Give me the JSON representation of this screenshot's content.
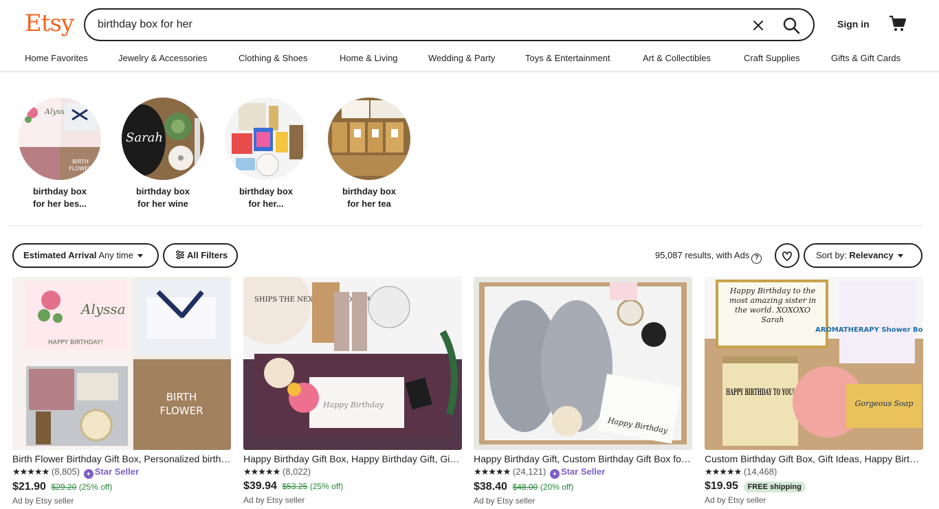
{
  "header": {
    "logo": "Etsy",
    "search_value": "birthday box for her",
    "sign_in": "Sign in"
  },
  "nav": [
    "Home Favorites",
    "Jewelry & Accessories",
    "Clothing & Shoes",
    "Home & Living",
    "Wedding & Party",
    "Toys & Entertainment",
    "Art & Collectibles",
    "Craft Supplies",
    "Gifts & Gift Cards"
  ],
  "related": [
    {
      "line1": "birthday box",
      "line2": "for her bes..."
    },
    {
      "line1": "birthday box",
      "line2": "for her wine"
    },
    {
      "line1": "birthday box",
      "line2": "for her..."
    },
    {
      "line1": "birthday box",
      "line2": "for her tea"
    }
  ],
  "filters": {
    "arrival_label": "Estimated Arrival",
    "arrival_value": "Any time",
    "all_filters": "All Filters",
    "results": "95,087 results, with Ads",
    "sort_label": "Sort by:",
    "sort_value": "Relevancy"
  },
  "products": [
    {
      "title": "Birth Flower Birthday Gift Box, Personalized birthday gift for her",
      "stars": "★★★★★",
      "reviews": "(8,805)",
      "star_seller": "Star Seller",
      "price": "$21.90",
      "orig": "$29.20",
      "off": "(25% off)",
      "free": "",
      "ad": "Ad by Etsy seller"
    },
    {
      "title": "Happy Birthday Gift Box, Happy Birthday Gift, Gift for her",
      "stars": "★★★★★",
      "reviews": "(8,022)",
      "star_seller": "",
      "price": "$39.94",
      "orig": "$53.25",
      "off": "(25% off)",
      "free": "",
      "ad": "Ad by Etsy seller"
    },
    {
      "title": "Happy Birthday Gift, Custom Birthday Gift Box for her",
      "stars": "★★★★★",
      "reviews": "(24,121)",
      "star_seller": "Star Seller",
      "price": "$38.40",
      "orig": "$48.00",
      "off": "(20% off)",
      "free": "",
      "ad": "Ad by Etsy seller"
    },
    {
      "title": "Custom Birthday Gift Box, Gift Ideas, Happy Birthday Box",
      "stars": "★★★★★",
      "reviews": "(14,468)",
      "star_seller": "",
      "price": "$19.95",
      "orig": "",
      "off": "",
      "free": "FREE shipping",
      "ad": "Ad by Etsy seller"
    }
  ],
  "image_text": {
    "p1_name": "Alyssa",
    "p1_hb": "HAPPY BIRTHDAY!",
    "p1_birth": "BIRTH",
    "p1_flower": "FLOWER",
    "p2_ships": "SHIPS THE NEXT DAY (MON-FRI)",
    "p2_card": "Happy Birthday",
    "p3_card": "Happy Birthday",
    "p4_card": "Happy Birthday to the most amazing sister in the world. XOXOXO Sarah",
    "p4_candle": "HAPPY BIRTHDAY TO YOU!",
    "p4_bag": "AROMATHERAPY Shower Bombs",
    "p4_soap": "Gorgeous Soap",
    "r2_name": "Sarah"
  },
  "colors": {
    "brand": "#f1641e",
    "sale": "#258635",
    "star_seller": "#7f5dc9"
  }
}
